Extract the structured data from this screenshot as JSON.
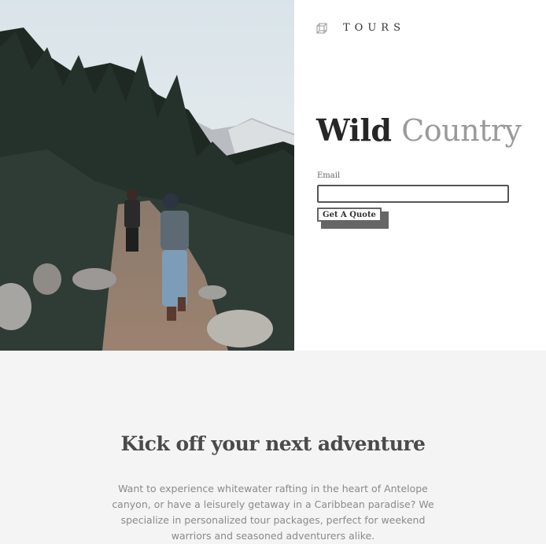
{
  "brand": {
    "icon": "cube-icon",
    "name": "TOURS"
  },
  "hero": {
    "title_bold": "Wild",
    "title_light": "Country",
    "email_label": "Email",
    "email_value": "",
    "email_placeholder": "",
    "cta_label": "Get A Quote",
    "photo_alt": "Hikers walking up a rocky trail through evergreen forest with mountains in the background"
  },
  "section": {
    "heading": "Kick off your next adventure",
    "body": "Want to experience whitewater rafting in the heart of Antelope canyon, or have a leisurely getaway in a Caribbean paradise? We specialize in personalized tour packages, perfect for weekend warriors and seasoned adventurers alike."
  },
  "colors": {
    "accent_dark": "#262626",
    "accent_light": "#9a9a9a",
    "section_bg": "#f4f4f4"
  }
}
